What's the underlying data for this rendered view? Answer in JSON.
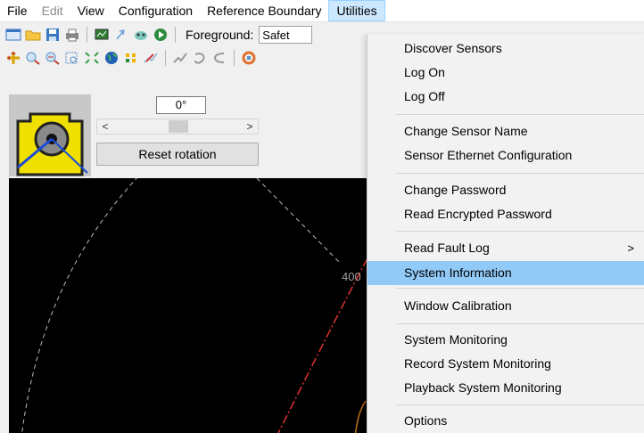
{
  "menubar": {
    "file": "File",
    "edit": "Edit",
    "view": "View",
    "configuration": "Configuration",
    "reference_boundary": "Reference Boundary",
    "utilities": "Utilities"
  },
  "toolbar": {
    "foreground_label": "Foreground:",
    "foreground_value": "Safet",
    "icons_row1": [
      "new-window-icon",
      "open-folder-icon",
      "save-icon",
      "print-icon",
      "monitor-icon",
      "pointer-icon",
      "sensor-icon",
      "play-icon"
    ],
    "icons_row2": [
      "move-icon",
      "zoom-in-icon",
      "zoom-out-icon",
      "fit-icon",
      "grid-icon",
      "globe-icon",
      "dots-icon",
      "edit-graph-icon",
      "gray-tool-icon",
      "lasso-icon",
      "measure-icon",
      "rotate-icon"
    ]
  },
  "rotation": {
    "degrees": "0°",
    "scroll_left": "<",
    "scroll_right": ">",
    "reset_label": "Reset rotation"
  },
  "canvas": {
    "range_label": "400"
  },
  "utilities_menu": {
    "items": [
      {
        "label": "Discover Sensors"
      },
      {
        "label": "Log On"
      },
      {
        "label": "Log Off"
      },
      {
        "label": "Change Sensor Name"
      },
      {
        "label": "Sensor Ethernet Configuration"
      },
      {
        "label": "Change Password"
      },
      {
        "label": "Read Encrypted Password"
      },
      {
        "label": "Read Fault Log",
        "submenu_arrow": ">"
      },
      {
        "label": "System Information",
        "highlighted": true
      },
      {
        "label": "Window Calibration"
      },
      {
        "label": "System Monitoring"
      },
      {
        "label": "Record System Monitoring"
      },
      {
        "label": "Playback System Monitoring"
      },
      {
        "label": "Options"
      }
    ]
  },
  "colors": {
    "highlight": "#91c9f7",
    "canvas_bg": "#000000",
    "boundary_red": "#e03030",
    "thumb_yellow": "#f0e000"
  }
}
